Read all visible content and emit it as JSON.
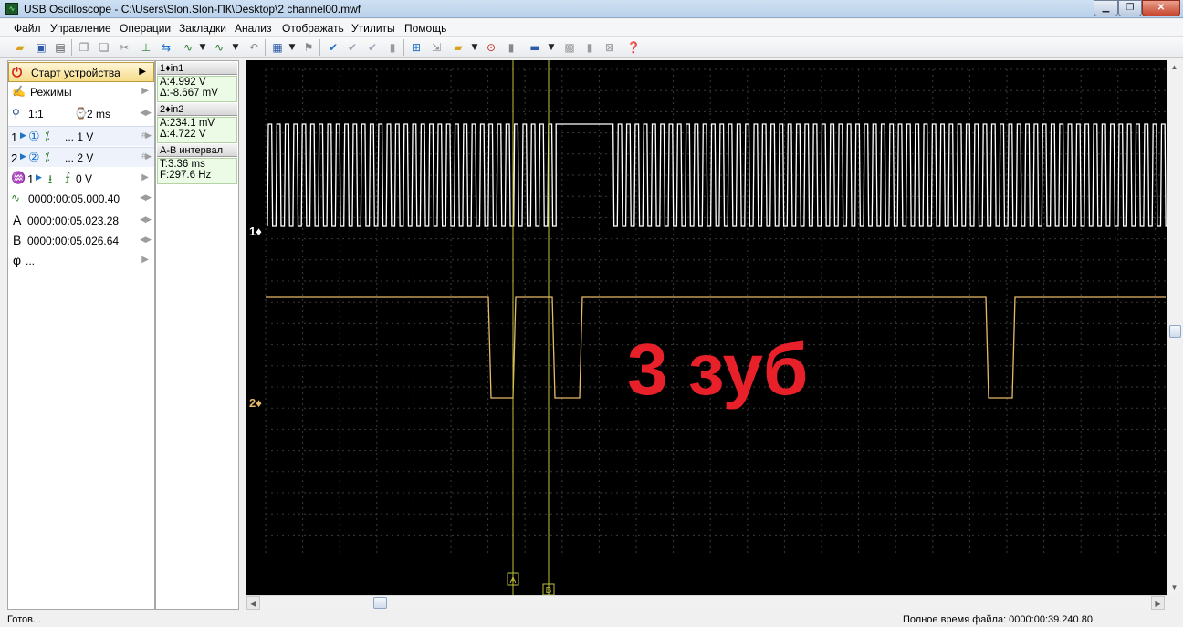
{
  "window": {
    "title": "USB Oscilloscope - C:\\Users\\Slon.Slon-ПК\\Desktop\\2 channel00.mwf",
    "min_glyph": "▁",
    "max_glyph": "❐",
    "close_glyph": "✕"
  },
  "menu": [
    "Файл",
    "Управление",
    "Операции",
    "Закладки",
    "Анализ",
    "Отображать",
    "Утилиты",
    "Помощь"
  ],
  "left_panel": {
    "start": "Старт устройства",
    "modes": "Режимы",
    "zoom": "1:1",
    "timebase": "2 ms",
    "ch1_num": "1",
    "ch1_volt": "... 1 V",
    "ch2_num": "2",
    "ch2_volt": "... 2 V",
    "trigger_ch": "1",
    "trigger_level": "0 V",
    "time_t": "0000:00:05.000.40",
    "cursor_a_label": "A",
    "cursor_a_time": "0000:00:05.023.28",
    "cursor_b_label": "B",
    "cursor_b_time": "0000:00:05.026.64",
    "phase_label": "φ",
    "phase_value": "..."
  },
  "info_panel": {
    "ch1_head": "1♦in1",
    "ch1_a": "A:4.992 V",
    "ch1_delta": "Δ:-8.667 mV",
    "ch2_head": "2♦in2",
    "ch2_a": "A:234.1 mV",
    "ch2_delta": "Δ:4.722 V",
    "interval_head": "A-B интервал",
    "interval_t": "T:3.36 ms",
    "interval_f": "F:297.6 Hz"
  },
  "scope": {
    "ch1_marker": "1♦",
    "ch2_marker": "2♦",
    "annotation": "3 зуб",
    "cursor_a": "A",
    "cursor_b": "B",
    "ch1_color": "#ffffff",
    "ch2_color": "#e8b86a",
    "cursor_color": "#bfbf3a",
    "annotation_color": "#e8202a"
  },
  "status": {
    "left": "Готов...",
    "right": "Полное время файла: 0000:00:39.240.80"
  }
}
